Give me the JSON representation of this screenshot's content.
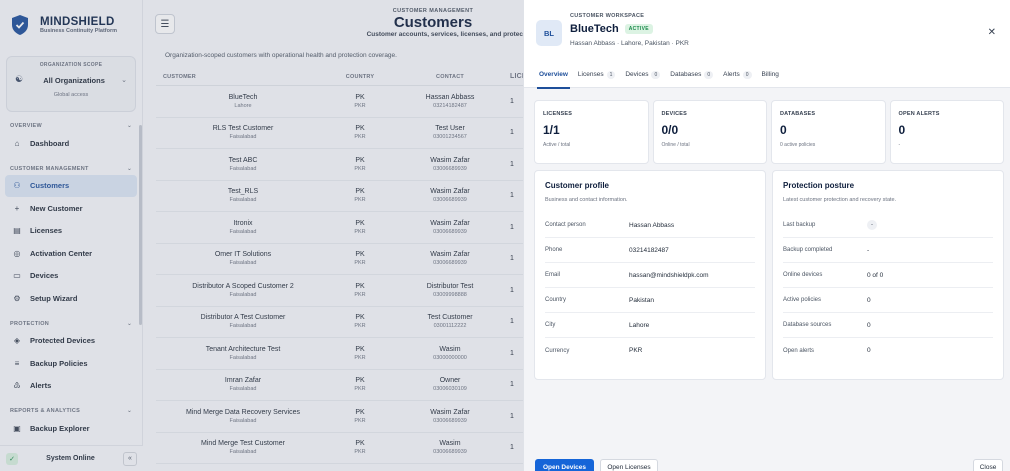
{
  "brand": {
    "name": "MINDSHIELD",
    "tagline": "Business Continuity Platform"
  },
  "org_scope": {
    "label": "ORGANIZATION SCOPE",
    "selected": "All Organizations",
    "note": "Global access"
  },
  "nav": {
    "sections": [
      {
        "label": "OVERVIEW",
        "items": [
          {
            "label": "Dashboard",
            "icon": "home-icon"
          }
        ]
      },
      {
        "label": "CUSTOMER MANAGEMENT",
        "items": [
          {
            "label": "Customers",
            "icon": "users-icon",
            "active": true
          },
          {
            "label": "New Customer",
            "icon": "plus-icon"
          },
          {
            "label": "Licenses",
            "icon": "license-icon"
          },
          {
            "label": "Activation Center",
            "icon": "target-icon"
          },
          {
            "label": "Devices",
            "icon": "monitor-icon"
          },
          {
            "label": "Setup Wizard",
            "icon": "gear-icon"
          }
        ]
      },
      {
        "label": "PROTECTION",
        "items": [
          {
            "label": "Protected Devices",
            "icon": "shield-check-icon"
          },
          {
            "label": "Backup Policies",
            "icon": "database-icon"
          },
          {
            "label": "Alerts",
            "icon": "bell-icon"
          }
        ]
      },
      {
        "label": "REPORTS & ANALYTICS",
        "items": [
          {
            "label": "Backup Explorer",
            "icon": "folder-icon"
          }
        ]
      }
    ],
    "footer": {
      "status": "System Online",
      "collapse": "«"
    }
  },
  "page": {
    "eyebrow": "CUSTOMER MANAGEMENT",
    "title": "Customers",
    "subtitle": "Customer accounts, services, licenses, and protec",
    "scope_note": "Organization-scoped customers with operational health and protection coverage."
  },
  "table": {
    "headers": [
      "CUSTOMER",
      "COUNTRY",
      "CONTACT",
      "LICENSE"
    ],
    "rows": [
      {
        "name": "BlueTech",
        "city": "Lahore",
        "country": "PK",
        "currency": "PKR",
        "contact": "Hassan Abbass",
        "phone": "03214182487",
        "lic": "1"
      },
      {
        "name": "RLS Test Customer",
        "city": "Faisalabad",
        "country": "PK",
        "currency": "PKR",
        "contact": "Test User",
        "phone": "03001234567",
        "lic": "1"
      },
      {
        "name": "Test ABC",
        "city": "Faisalabad",
        "country": "PK",
        "currency": "PKR",
        "contact": "Wasim Zafar",
        "phone": "03006689939",
        "lic": "1"
      },
      {
        "name": "Test_RLS",
        "city": "Faisalabad",
        "country": "PK",
        "currency": "PKR",
        "contact": "Wasim Zafar",
        "phone": "03006689939",
        "lic": "1"
      },
      {
        "name": "Itronix",
        "city": "Faisalabad",
        "country": "PK",
        "currency": "PKR",
        "contact": "Wasim Zafar",
        "phone": "03006689939",
        "lic": "1"
      },
      {
        "name": "Omer IT Solutions",
        "city": "Faisalabad",
        "country": "PK",
        "currency": "PKR",
        "contact": "Wasim Zafar",
        "phone": "03006689939",
        "lic": "1"
      },
      {
        "name": "Distributor A Scoped Customer 2",
        "city": "Faisalabad",
        "country": "PK",
        "currency": "PKR",
        "contact": "Distributor Test",
        "phone": "03009998888",
        "lic": "1"
      },
      {
        "name": "Distributor A Test Customer",
        "city": "Faisalabad",
        "country": "PK",
        "currency": "PKR",
        "contact": "Test Customer",
        "phone": "03001112222",
        "lic": "1"
      },
      {
        "name": "Tenant Architecture Test",
        "city": "Faisalabad",
        "country": "PK",
        "currency": "PKR",
        "contact": "Wasim",
        "phone": "03000000000",
        "lic": "1"
      },
      {
        "name": "Imran Zafar",
        "city": "Faisalabad",
        "country": "PK",
        "currency": "PKR",
        "contact": "Owner",
        "phone": "03006030109",
        "lic": "1"
      },
      {
        "name": "Mind Merge Data Recovery Services",
        "city": "Faisalabad",
        "country": "PK",
        "currency": "PKR",
        "contact": "Wasim Zafar",
        "phone": "03006689939",
        "lic": "1"
      },
      {
        "name": "Mind Merge Test Customer",
        "city": "Faisalabad",
        "country": "PK",
        "currency": "PKR",
        "contact": "Wasim",
        "phone": "03006689939",
        "lic": "1"
      }
    ]
  },
  "drawer": {
    "eyebrow": "CUSTOMER WORKSPACE",
    "initials": "BL",
    "title": "BlueTech",
    "badge": "ACTIVE",
    "location": "Hassan Abbass · Lahore, Pakistan · PKR",
    "tabs": [
      {
        "label": "Overview",
        "count": null,
        "active": true
      },
      {
        "label": "Licenses",
        "count": "1"
      },
      {
        "label": "Devices",
        "count": "0"
      },
      {
        "label": "Databases",
        "count": "0"
      },
      {
        "label": "Alerts",
        "count": "0"
      },
      {
        "label": "Billing",
        "count": null
      }
    ],
    "stats": [
      {
        "label": "LICENSES",
        "value": "1/1",
        "sub": "Active / total"
      },
      {
        "label": "DEVICES",
        "value": "0/0",
        "sub": "Online / total"
      },
      {
        "label": "DATABASES",
        "value": "0",
        "sub": "0 active policies"
      },
      {
        "label": "OPEN ALERTS",
        "value": "0",
        "sub": "-"
      }
    ],
    "profile": {
      "title": "Customer profile",
      "subtitle": "Business and contact information.",
      "rows": [
        {
          "k": "Contact person",
          "v": "Hassan Abbass"
        },
        {
          "k": "Phone",
          "v": "03214182487"
        },
        {
          "k": "Email",
          "v": "hassan@mindshieldpk.com"
        },
        {
          "k": "Country",
          "v": "Pakistan"
        },
        {
          "k": "City",
          "v": "Lahore"
        },
        {
          "k": "Currency",
          "v": "PKR"
        }
      ]
    },
    "posture": {
      "title": "Protection posture",
      "subtitle": "Latest customer protection and recovery state.",
      "rows": [
        {
          "k": "Last backup",
          "v": "-"
        },
        {
          "k": "Backup completed",
          "v": "-"
        },
        {
          "k": "Online devices",
          "v": "0 of 0"
        },
        {
          "k": "Active policies",
          "v": "0"
        },
        {
          "k": "Database sources",
          "v": "0"
        },
        {
          "k": "Open alerts",
          "v": "0"
        }
      ]
    },
    "footer": {
      "primary": "Open Devices",
      "secondary": "Open Licenses",
      "close": "Close"
    }
  }
}
